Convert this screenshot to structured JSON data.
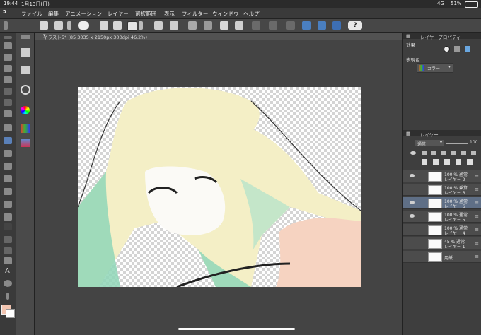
{
  "status": {
    "time": "19:44",
    "date": "1月13日(日)",
    "network": "4G",
    "battery": "51%"
  },
  "menu": [
    "ファイル",
    "編集",
    "アニメーション",
    "レイヤー",
    "選択範囲",
    "表示",
    "フィルター",
    "ウィンドウ",
    "ヘルプ"
  ],
  "document": {
    "tab_title": "イラスト5* (85 3035 x 2150px 300dpi 46.2%)"
  },
  "layer_property": {
    "title": "レイヤープロパティ",
    "effect_label": "効果",
    "expression_color_label": "表現色",
    "expression_color_value": "カラー"
  },
  "layers": {
    "title": "レイヤー",
    "blend_mode": "通常",
    "opacity": "100",
    "items": [
      {
        "line1": "100 % 通常",
        "line2": "レイヤー 2",
        "selected": false
      },
      {
        "line1": "100 % 乗算",
        "line2": "レイヤー 3",
        "selected": false
      },
      {
        "line1": "100 % 通常",
        "line2": "レイヤー 6",
        "selected": true
      },
      {
        "line1": "100 % 通常",
        "line2": "レイヤー 5",
        "selected": false
      },
      {
        "line1": "100 % 通常",
        "line2": "レイヤー 4",
        "selected": false
      },
      {
        "line1": "45 % 通常",
        "line2": "レイヤー 1",
        "selected": false
      },
      {
        "line1": "",
        "line2": "用紙",
        "selected": false
      }
    ]
  },
  "colors": {
    "main_color": "#f2c4b0",
    "sub_color": "#ffffff",
    "selection_blue": "#5f6f86"
  }
}
